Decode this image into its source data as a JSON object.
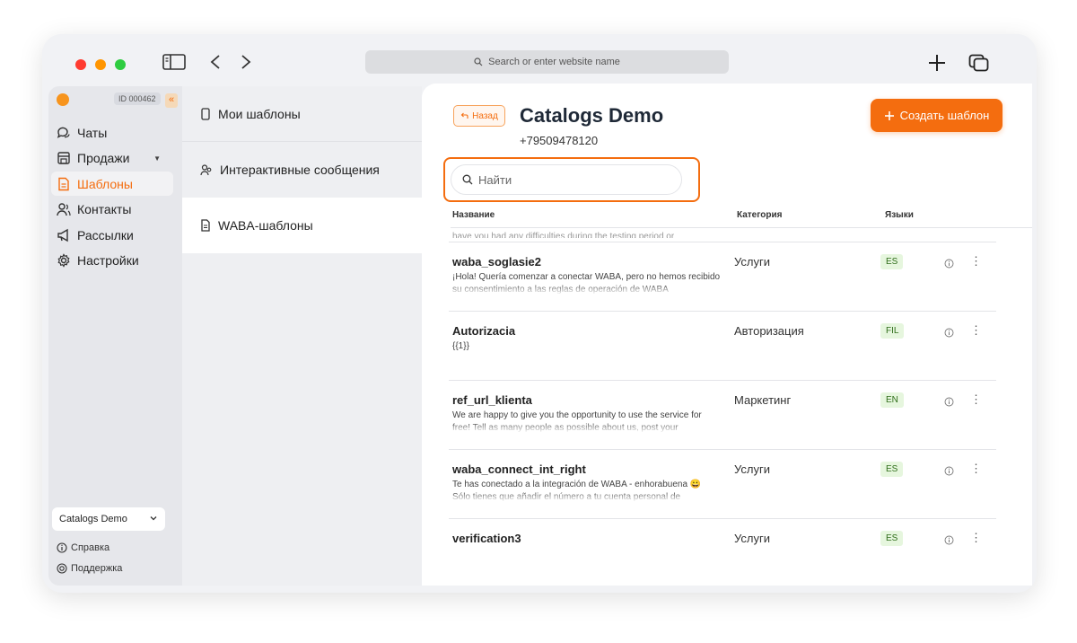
{
  "browser": {
    "address_placeholder": "Search or enter website name"
  },
  "sidebar": {
    "id_badge": "ID 000462",
    "collapse_label": "«",
    "items": [
      {
        "label": "Чаты",
        "icon": "chat-icon"
      },
      {
        "label": "Продажи",
        "icon": "store-icon",
        "has_caret": true
      },
      {
        "label": "Шаблоны",
        "icon": "document-icon",
        "active": true
      },
      {
        "label": "Контакты",
        "icon": "contacts-icon"
      },
      {
        "label": "Рассылки",
        "icon": "megaphone-icon"
      },
      {
        "label": "Настройки",
        "icon": "gear-icon"
      }
    ],
    "account_select": "Catalogs Demo",
    "help_label": "Справка",
    "support_label": "Поддержка"
  },
  "template_types": [
    {
      "label": "Мои шаблоны",
      "icon": "phone-icon"
    },
    {
      "label": "Интерактивные сообщения",
      "icon": "users-icon"
    },
    {
      "label": "WABA-шаблоны",
      "icon": "file-icon",
      "active": true
    }
  ],
  "main": {
    "back_label": "Назад",
    "title": "Catalogs Demo",
    "phone": "+79509478120",
    "create_label": "Создать шаблон",
    "search_placeholder": "Найти",
    "columns": {
      "name": "Название",
      "category": "Категория",
      "languages": "Языки"
    },
    "cut_off_text": "have you had any difficulties during the testing period or",
    "rows": [
      {
        "name": "waba_soglasie2",
        "desc": "¡Hola! Quería comenzar a conectar WABA, pero no hemos recibido su consentimiento a las reglas de operación de WABA",
        "category": "Услуги",
        "lang": "ES"
      },
      {
        "name": "Autorizacia",
        "desc": "{{1}}",
        "category": "Авторизация",
        "lang": "FIL"
      },
      {
        "name": "ref_url_klienta",
        "desc": "We are happy to give you the opportunity to use the service for free! Tell as many people as possible about us, post your",
        "category": "Маркетинг",
        "lang": "EN"
      },
      {
        "name": "waba_connect_int_right",
        "desc": "Te has conectado a la integración de WABA - enhorabuena 😀 Sólo tienes que añadir el número a tu cuenta personal de",
        "category": "Услуги",
        "lang": "ES"
      },
      {
        "name": "verification3",
        "desc": "",
        "category": "Услуги",
        "lang": "ES"
      }
    ]
  },
  "colors": {
    "accent": "#f46d0f",
    "badge_bg": "#e6f6de"
  }
}
